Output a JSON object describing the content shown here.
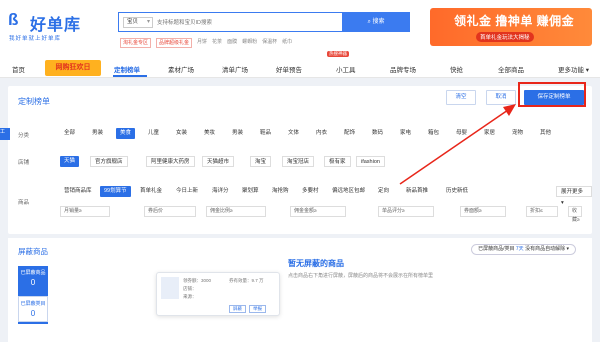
{
  "logo": {
    "name": "好单库",
    "slogan": "我好单就上好单库"
  },
  "search": {
    "scope": "宝贝",
    "placeholder": "支持标题和宝贝ID搜索",
    "button": "搜索"
  },
  "hot_tags": [
    "淘礼金专区",
    "品牌超级礼金",
    "月饼",
    "花茶",
    "面膜",
    "螺蛳粉",
    "保温杯",
    "纸巾"
  ],
  "banner": {
    "headline": "领礼金 撸神单 赚佣金",
    "sub": "首单礼金玩法大揭秘"
  },
  "nav": {
    "items": [
      "首页",
      "网购狂欢日",
      "定制榜单",
      "素材广场",
      "清单广场",
      "好单预告",
      "小工具",
      "品牌专场",
      "快抢",
      "全部商品",
      "更多功能"
    ],
    "hot_badge": "热搜神器"
  },
  "panel": {
    "title": "定制榜单",
    "btn_clear": "清空",
    "btn_cancel": "取消",
    "btn_save": "保存定制榜单"
  },
  "categories": {
    "label": "分类",
    "items": [
      "全部",
      "男装",
      "美食",
      "儿童",
      "女装",
      "美妆",
      "男装",
      "鞋品",
      "文体",
      "内衣",
      "配饰",
      "数码",
      "家电",
      "箱包",
      "母婴",
      "家居",
      "宠物",
      "其他"
    ],
    "selected": "美食"
  },
  "shops": {
    "label": "店铺",
    "items": [
      "天猫",
      "官方旗舰店",
      "阿里健康大药房",
      "天猫超市",
      "淘宝",
      "淘宝冠店",
      "极有家",
      "ifashion"
    ],
    "selected": "天猫"
  },
  "goods": {
    "label": "商品",
    "items": [
      "营销商品库",
      "99划算节",
      "首单礼金",
      "今日上新",
      "海详分",
      "聚划算",
      "淘抢购",
      "多要村",
      "偏远地区包邮",
      "定向",
      "新品首推",
      "历史新低"
    ],
    "selected": "99划算节",
    "expand": "展开更多"
  },
  "ranges": [
    {
      "left": "月销量≥",
      "unit": "笔"
    },
    {
      "left": "券后价",
      "unit": "-"
    },
    {
      "left": "佣金比例≥",
      "unit": "%"
    },
    {
      "left": "佣金金额≥",
      "unit": ""
    },
    {
      "left": "单品评分≥",
      "unit": ""
    },
    {
      "left": "券面额≥",
      "unit": ""
    },
    {
      "left": "折扣≤",
      "unit": "折"
    },
    {
      "left": "收藏≥",
      "unit": "万"
    }
  ],
  "blocked": {
    "title": "屏蔽商品",
    "filter_text": "已屏蔽商品/类目",
    "filter_count": "7天",
    "filter_action": "没有商品自动解除",
    "card1_label": "已屏蔽商品",
    "card1_count": "0",
    "card2_label": "已屏蔽类目",
    "card2_count": "0",
    "mock": {
      "line1": "领券额：3000",
      "line2": "券有效量：9.7 万",
      "line3": "店铺：",
      "line4": "来源：",
      "btn1": "屏蔽",
      "btn2": "举报"
    },
    "empty_title": "暂无屏蔽的商品",
    "empty_sub": "点击商品右下角进行屏蔽，屏蔽后的商品将不会展示在所有榜单里"
  },
  "colors": {
    "accent": "#2b6fe6",
    "highlight": "#e8261a",
    "banner": "#ff6a2a"
  }
}
